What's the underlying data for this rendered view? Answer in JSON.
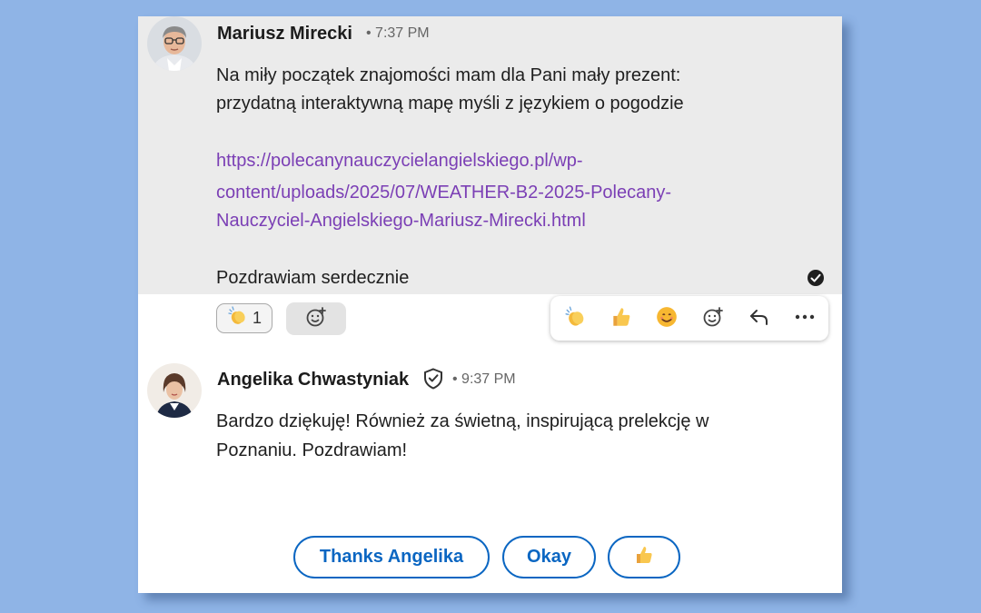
{
  "message1": {
    "sender": "Mariusz Mirecki",
    "time": "• 7:37 PM",
    "line1": "Na miły początek znajomości mam dla Pani mały prezent:",
    "line2": "przydatną interaktywną mapę myśli z językiem o pogodzie",
    "link_line1": "https://polecanynauczycielangielskiego.pl/wp-",
    "link_line2": "content/uploads/2025/07/WEATHER-B2-2025-Polecany-",
    "link_line3": "Nauczyciel-Angielskiego-Mariusz-Mirecki.html",
    "closing": "Pozdrawiam serdecznie",
    "reaction": {
      "icon": "clapping-hands-icon",
      "count": "1"
    }
  },
  "actions": [
    "clapping-hands-icon",
    "thumbs-up-icon",
    "smile-icon",
    "add-reaction-icon",
    "reply-icon",
    "more-icon"
  ],
  "message2": {
    "sender": "Angelika Chwastyniak",
    "time": "• 9:37 PM",
    "line1": "Bardzo dziękuję! Również za świetną, inspirującą prelekcję w",
    "line2": "Poznaniu. Pozdrawiam!"
  },
  "quick_replies": {
    "reply1": "Thanks Angelika",
    "reply2": "Okay",
    "reply3": "👍"
  },
  "colors": {
    "background": "#8fb4e6",
    "link": "#7b3fb5",
    "accent": "#0a66c2",
    "highlight_bg": "#ebebeb"
  }
}
